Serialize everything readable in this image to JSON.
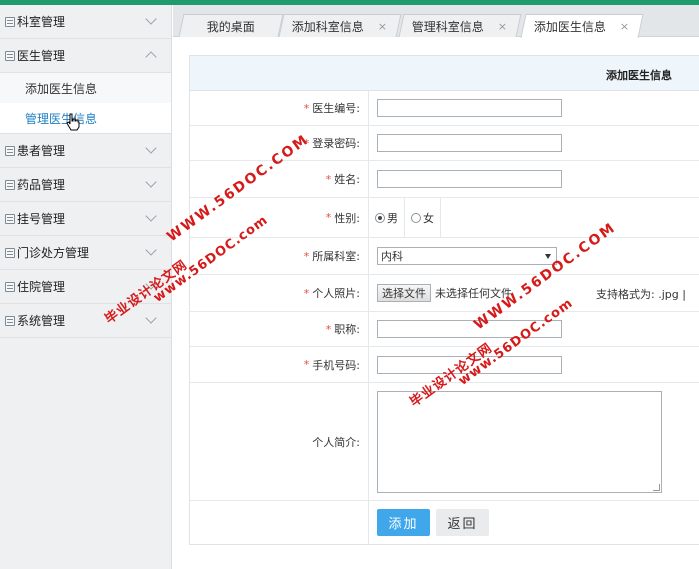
{
  "sidebar": {
    "groups": [
      {
        "label": "科室管理"
      },
      {
        "label": "医生管理",
        "children": [
          {
            "label": "添加医生信息"
          },
          {
            "label": "管理医生信息"
          }
        ]
      },
      {
        "label": "患者管理"
      },
      {
        "label": "药品管理"
      },
      {
        "label": "挂号管理"
      },
      {
        "label": "门诊处方管理"
      },
      {
        "label": "住院管理"
      },
      {
        "label": "系统管理"
      }
    ]
  },
  "tabs": [
    {
      "label": "我的桌面"
    },
    {
      "label": "添加科室信息",
      "close": "×"
    },
    {
      "label": "管理科室信息",
      "close": "×"
    },
    {
      "label": "添加医生信息",
      "close": "×"
    }
  ],
  "form": {
    "title": "添加医生信息",
    "required_mark": "*",
    "fields": {
      "doctor_id": {
        "label": "医生编号:",
        "value": ""
      },
      "password": {
        "label": "登录密码:",
        "value": ""
      },
      "name": {
        "label": "姓名:",
        "value": ""
      },
      "gender": {
        "label": "性别:",
        "options": [
          "男",
          "女"
        ],
        "selected": "男"
      },
      "department": {
        "label": "所属科室:",
        "selected": "内科"
      },
      "photo": {
        "label": "个人照片:",
        "button": "选择文件",
        "status": "未选择任何文件",
        "hint": "支持格式为: .jpg |"
      },
      "title": {
        "label": "职称:",
        "value": ""
      },
      "phone": {
        "label": "手机号码:",
        "value": ""
      },
      "bio": {
        "label": "个人简介:",
        "value": ""
      }
    },
    "buttons": {
      "add": "添加",
      "back": "返回"
    }
  },
  "watermarks": {
    "site": "www.56DOC.com",
    "name": "毕业设计论文网",
    "site_caps": "WWW.56DOC.COM"
  },
  "colors": {
    "accent": "#1f9b6e",
    "primary_button": "#3fa7ea",
    "required": "#e84c3d",
    "active_link": "#1e7fc5",
    "watermark": "#d61a1a"
  }
}
